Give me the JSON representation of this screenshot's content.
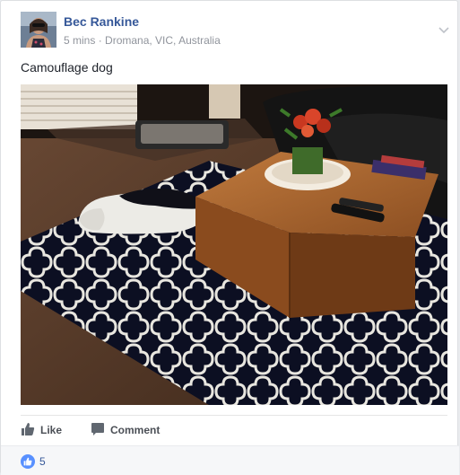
{
  "post": {
    "author": "Bec Rankine",
    "time": "5 mins",
    "separator": "·",
    "location": "Dromana, VIC, Australia",
    "text": "Camouflage dog"
  },
  "actions": {
    "like_label": "Like",
    "comment_label": "Comment"
  },
  "reactions": {
    "count": "5"
  },
  "colors": {
    "link": "#365899",
    "like_blue": "#5890ff",
    "muted": "#90949c"
  },
  "icons": [
    "chevron-down-icon",
    "thumbs-up-icon",
    "comment-icon",
    "like-reaction-icon",
    "globe-icon"
  ]
}
